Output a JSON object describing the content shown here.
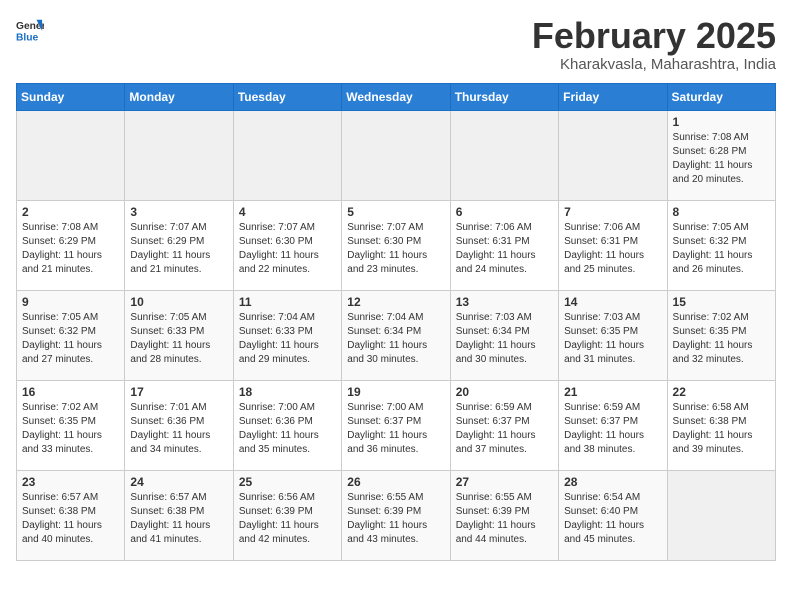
{
  "header": {
    "logo_general": "General",
    "logo_blue": "Blue",
    "month_title": "February 2025",
    "location": "Kharakvasla, Maharashtra, India"
  },
  "weekdays": [
    "Sunday",
    "Monday",
    "Tuesday",
    "Wednesday",
    "Thursday",
    "Friday",
    "Saturday"
  ],
  "weeks": [
    [
      {
        "day": "",
        "info": ""
      },
      {
        "day": "",
        "info": ""
      },
      {
        "day": "",
        "info": ""
      },
      {
        "day": "",
        "info": ""
      },
      {
        "day": "",
        "info": ""
      },
      {
        "day": "",
        "info": ""
      },
      {
        "day": "1",
        "info": "Sunrise: 7:08 AM\nSunset: 6:28 PM\nDaylight: 11 hours and 20 minutes."
      }
    ],
    [
      {
        "day": "2",
        "info": "Sunrise: 7:08 AM\nSunset: 6:29 PM\nDaylight: 11 hours and 21 minutes."
      },
      {
        "day": "3",
        "info": "Sunrise: 7:07 AM\nSunset: 6:29 PM\nDaylight: 11 hours and 21 minutes."
      },
      {
        "day": "4",
        "info": "Sunrise: 7:07 AM\nSunset: 6:30 PM\nDaylight: 11 hours and 22 minutes."
      },
      {
        "day": "5",
        "info": "Sunrise: 7:07 AM\nSunset: 6:30 PM\nDaylight: 11 hours and 23 minutes."
      },
      {
        "day": "6",
        "info": "Sunrise: 7:06 AM\nSunset: 6:31 PM\nDaylight: 11 hours and 24 minutes."
      },
      {
        "day": "7",
        "info": "Sunrise: 7:06 AM\nSunset: 6:31 PM\nDaylight: 11 hours and 25 minutes."
      },
      {
        "day": "8",
        "info": "Sunrise: 7:05 AM\nSunset: 6:32 PM\nDaylight: 11 hours and 26 minutes."
      }
    ],
    [
      {
        "day": "9",
        "info": "Sunrise: 7:05 AM\nSunset: 6:32 PM\nDaylight: 11 hours and 27 minutes."
      },
      {
        "day": "10",
        "info": "Sunrise: 7:05 AM\nSunset: 6:33 PM\nDaylight: 11 hours and 28 minutes."
      },
      {
        "day": "11",
        "info": "Sunrise: 7:04 AM\nSunset: 6:33 PM\nDaylight: 11 hours and 29 minutes."
      },
      {
        "day": "12",
        "info": "Sunrise: 7:04 AM\nSunset: 6:34 PM\nDaylight: 11 hours and 30 minutes."
      },
      {
        "day": "13",
        "info": "Sunrise: 7:03 AM\nSunset: 6:34 PM\nDaylight: 11 hours and 30 minutes."
      },
      {
        "day": "14",
        "info": "Sunrise: 7:03 AM\nSunset: 6:35 PM\nDaylight: 11 hours and 31 minutes."
      },
      {
        "day": "15",
        "info": "Sunrise: 7:02 AM\nSunset: 6:35 PM\nDaylight: 11 hours and 32 minutes."
      }
    ],
    [
      {
        "day": "16",
        "info": "Sunrise: 7:02 AM\nSunset: 6:35 PM\nDaylight: 11 hours and 33 minutes."
      },
      {
        "day": "17",
        "info": "Sunrise: 7:01 AM\nSunset: 6:36 PM\nDaylight: 11 hours and 34 minutes."
      },
      {
        "day": "18",
        "info": "Sunrise: 7:00 AM\nSunset: 6:36 PM\nDaylight: 11 hours and 35 minutes."
      },
      {
        "day": "19",
        "info": "Sunrise: 7:00 AM\nSunset: 6:37 PM\nDaylight: 11 hours and 36 minutes."
      },
      {
        "day": "20",
        "info": "Sunrise: 6:59 AM\nSunset: 6:37 PM\nDaylight: 11 hours and 37 minutes."
      },
      {
        "day": "21",
        "info": "Sunrise: 6:59 AM\nSunset: 6:37 PM\nDaylight: 11 hours and 38 minutes."
      },
      {
        "day": "22",
        "info": "Sunrise: 6:58 AM\nSunset: 6:38 PM\nDaylight: 11 hours and 39 minutes."
      }
    ],
    [
      {
        "day": "23",
        "info": "Sunrise: 6:57 AM\nSunset: 6:38 PM\nDaylight: 11 hours and 40 minutes."
      },
      {
        "day": "24",
        "info": "Sunrise: 6:57 AM\nSunset: 6:38 PM\nDaylight: 11 hours and 41 minutes."
      },
      {
        "day": "25",
        "info": "Sunrise: 6:56 AM\nSunset: 6:39 PM\nDaylight: 11 hours and 42 minutes."
      },
      {
        "day": "26",
        "info": "Sunrise: 6:55 AM\nSunset: 6:39 PM\nDaylight: 11 hours and 43 minutes."
      },
      {
        "day": "27",
        "info": "Sunrise: 6:55 AM\nSunset: 6:39 PM\nDaylight: 11 hours and 44 minutes."
      },
      {
        "day": "28",
        "info": "Sunrise: 6:54 AM\nSunset: 6:40 PM\nDaylight: 11 hours and 45 minutes."
      },
      {
        "day": "",
        "info": ""
      }
    ]
  ]
}
